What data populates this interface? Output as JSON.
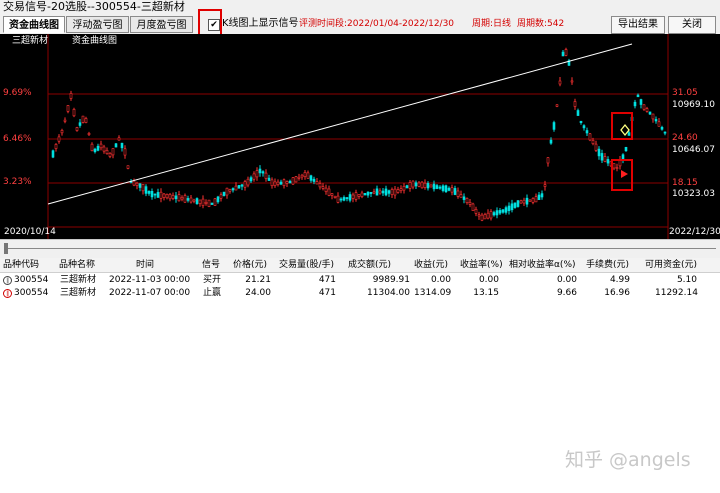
{
  "window": {
    "title": "交易信号-20选股--300554-三超新材"
  },
  "tabs": [
    {
      "label": "资金曲线图",
      "active": true
    },
    {
      "label": "浮动盈亏图",
      "active": false
    },
    {
      "label": "月度盈亏图",
      "active": false
    }
  ],
  "toolbar": {
    "show_signals_checked": true,
    "show_signals_check_glyph": "✔",
    "show_signals_label": "K线图上显示信号",
    "eval_period_label": "评测时间段:2022/01/04-2022/12/30",
    "cycle_label": "周期:日线",
    "period_count_label": "周期数:542",
    "export_button": "导出结果",
    "close_button": "关闭"
  },
  "chart": {
    "legend_stock": "三超新材",
    "legend_equity": "资金曲线图",
    "price_axis_labels": [
      "9.69%",
      "6.46%",
      "3.23%"
    ],
    "right_axis_price": [
      "31.05",
      "24.60",
      "18.15"
    ],
    "right_axis_equity": [
      "10969.10",
      "10646.07",
      "10323.03"
    ],
    "date_start": "2020/10/14",
    "date_end": "2022/12/30",
    "colors": {
      "up": "#ff3232",
      "down": "#00e0e0",
      "trendline": "#ffffff",
      "grid": "#8b0000",
      "label_red": "#ff4040"
    },
    "signal_buy_icon": "diamond-icon",
    "signal_sell_icon": "red-arrow-icon"
  },
  "table": {
    "columns": [
      "品种代码",
      "品种名称",
      "时间",
      "信号",
      "价格(元)",
      "交易量(股/手)",
      "成交额(元)",
      "收益(元)",
      "收益率(%)",
      "相对收益率α(%)",
      "手续费(元)",
      "可用资金(元)"
    ],
    "rows": [
      {
        "icon": "open-position-icon",
        "code": "300554",
        "name": "三超新材",
        "time": "2022-11-03 00:00",
        "signal": "买开",
        "price": "21.21",
        "volume": "471",
        "amount": "9989.91",
        "profit": "0.00",
        "return": "0.00",
        "alpha": "0.00",
        "fee": "4.99",
        "cash": "5.10"
      },
      {
        "icon": "take-profit-icon",
        "code": "300554",
        "name": "三超新材",
        "time": "2022-11-07 00:00",
        "signal": "止赢",
        "price": "24.00",
        "volume": "471",
        "amount": "11304.00",
        "profit": "1314.09",
        "return": "13.15",
        "alpha": "9.66",
        "fee": "16.96",
        "cash": "11292.14"
      }
    ]
  },
  "watermark": "知乎 @angels"
}
